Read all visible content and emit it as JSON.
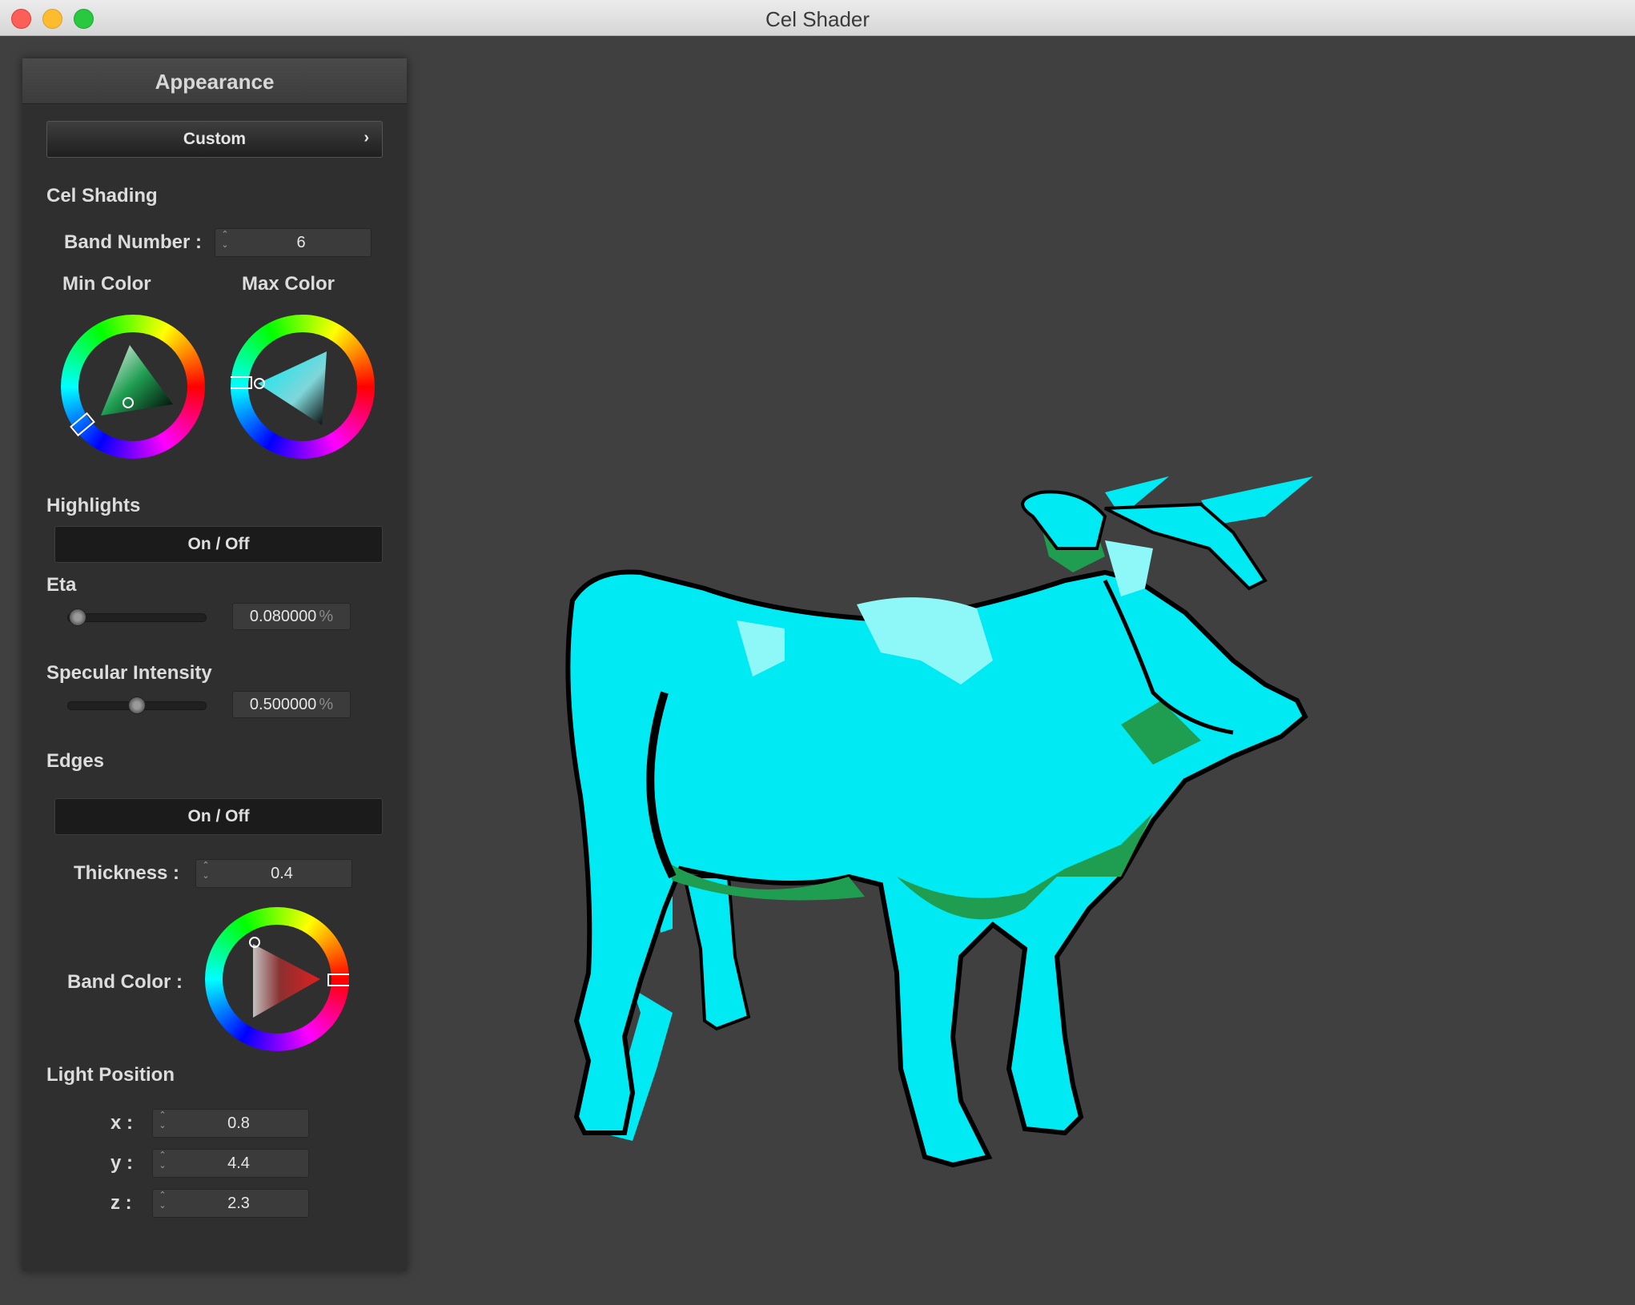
{
  "window": {
    "title": "Cel Shader"
  },
  "panel": {
    "header": "Appearance",
    "preset": {
      "label": "Custom",
      "chevron": "›"
    },
    "cel_shading": {
      "section": "Cel Shading",
      "band_number_label": "Band Number :",
      "band_number_value": "6",
      "min_color_label": "Min Color",
      "max_color_label": "Max Color",
      "min_color": "#1f9e52",
      "max_color": "#00e8f0"
    },
    "highlights": {
      "section": "Highlights",
      "toggle_label": "On / Off"
    },
    "eta": {
      "section": "Eta",
      "value": "0.080000",
      "unit": "%",
      "level": 0.08
    },
    "specular": {
      "section": "Specular Intensity",
      "value": "0.500000",
      "unit": "%",
      "level": 0.5
    },
    "edges": {
      "section": "Edges",
      "toggle_label": "On / Off",
      "thickness_label": "Thickness :",
      "thickness_value": "0.4",
      "band_color_label": "Band Color :",
      "band_color": "#e02020"
    },
    "light_position": {
      "section": "Light Position",
      "x_label": "x :",
      "x_value": "0.8",
      "y_label": "y :",
      "y_value": "4.4",
      "z_label": "z :",
      "z_value": "2.3"
    }
  },
  "viewport": {
    "model": "cow",
    "fill_color": "#00eaf4",
    "shadow_color": "#1f9e52",
    "highlight_color": "#8ef8f8",
    "edge_color": "#000000"
  },
  "icons": [
    "close-icon",
    "minimize-icon",
    "maximize-icon",
    "chevron-right-icon",
    "stepper-icon",
    "color-wheel-icon"
  ]
}
